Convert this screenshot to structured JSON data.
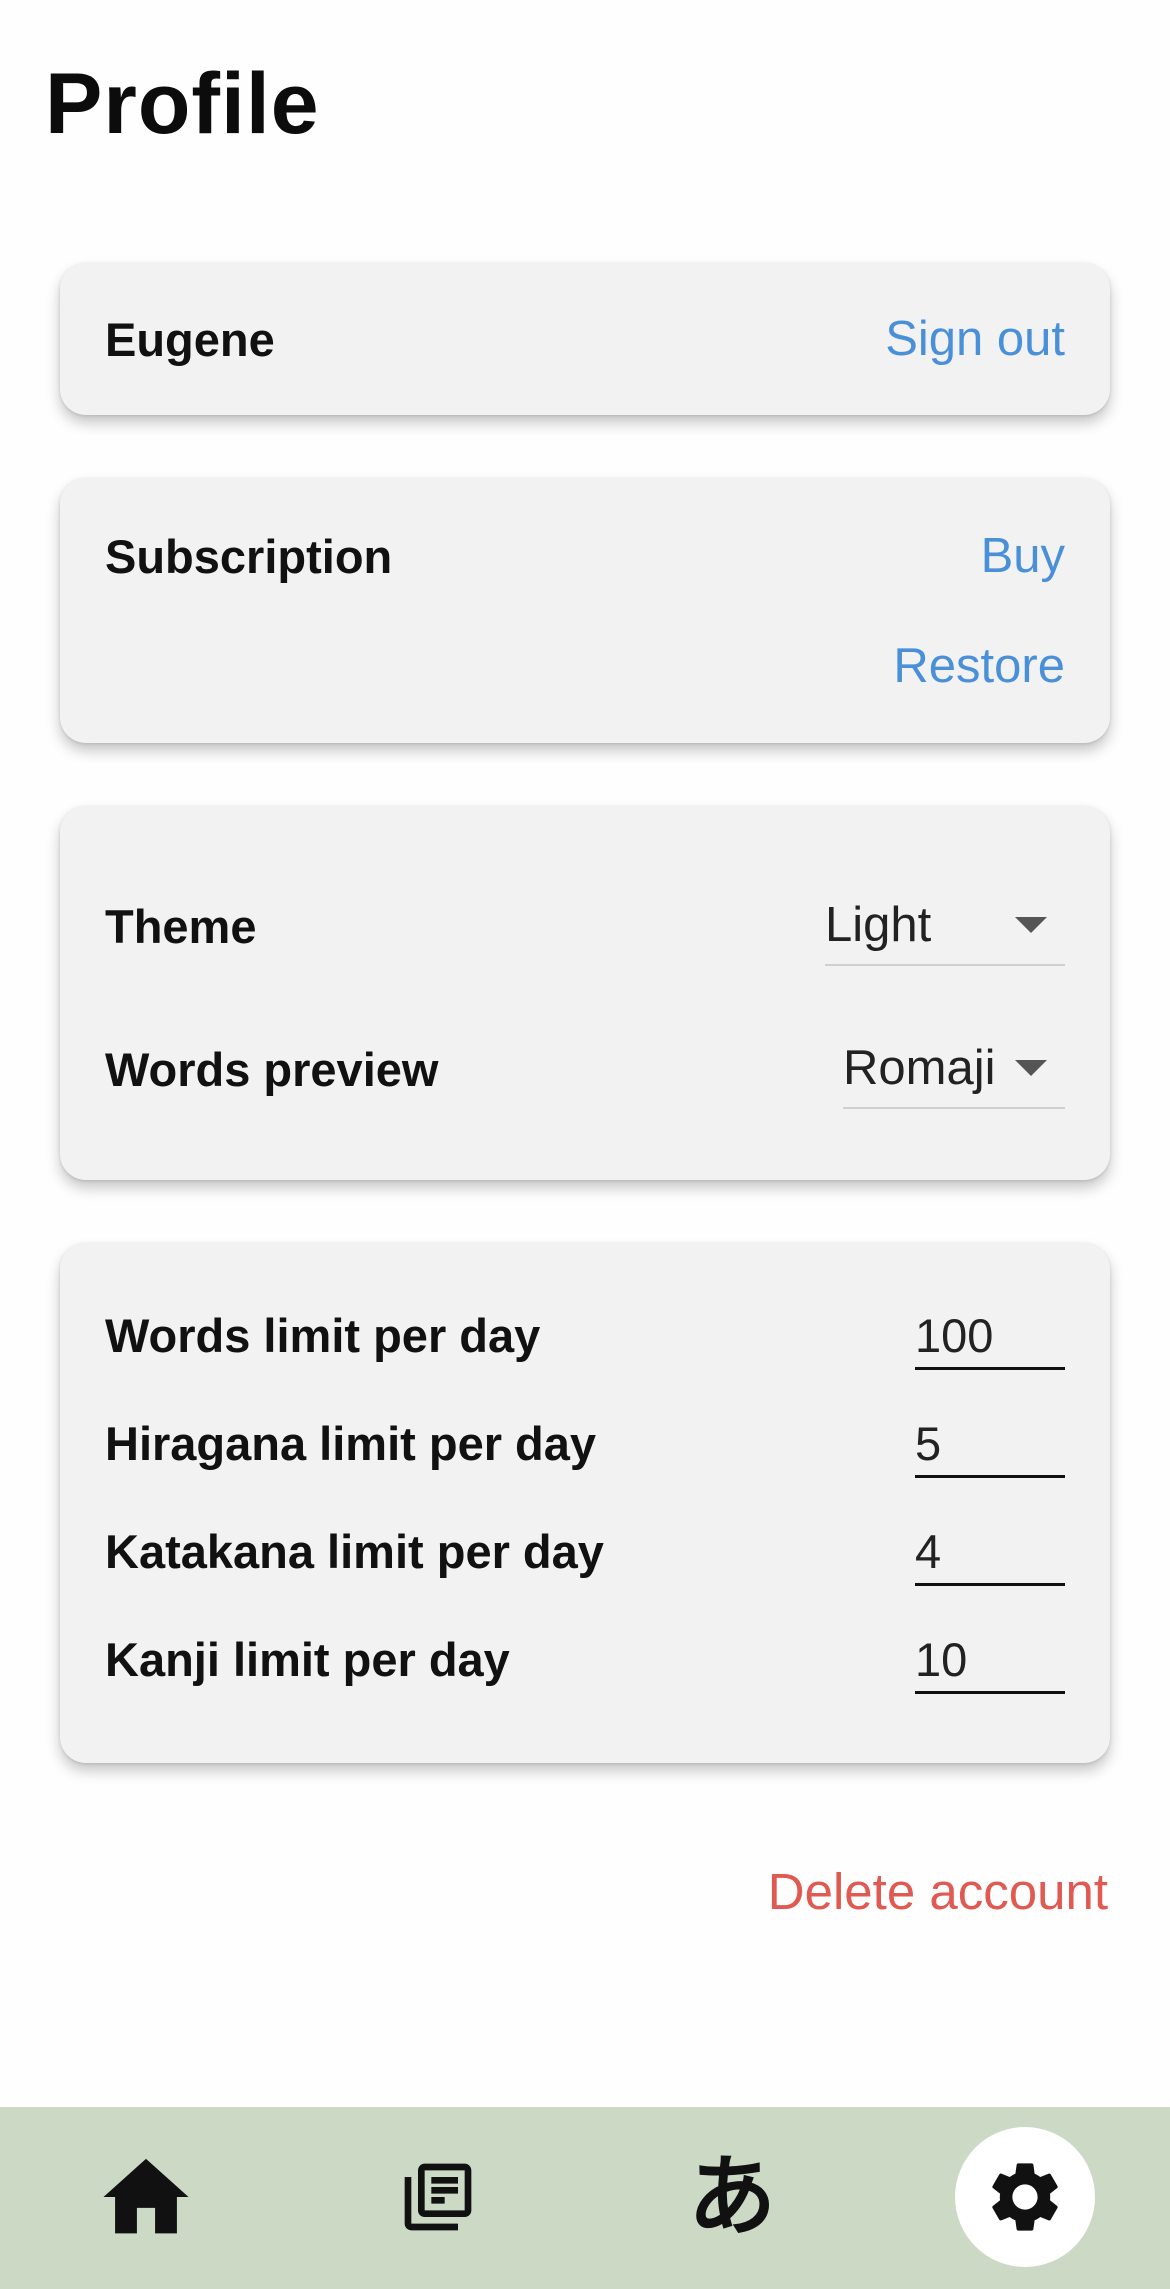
{
  "header": {
    "title": "Profile"
  },
  "account": {
    "name": "Eugene",
    "sign_out_label": "Sign out"
  },
  "subscription": {
    "label": "Subscription",
    "buy_label": "Buy",
    "restore_label": "Restore"
  },
  "preferences": {
    "theme": {
      "label": "Theme",
      "value": "Light"
    },
    "words_preview": {
      "label": "Words preview",
      "value": "Romaji"
    }
  },
  "limits": [
    {
      "label": "Words limit per day",
      "value": "100"
    },
    {
      "label": "Hiragana limit per day",
      "value": "5"
    },
    {
      "label": "Katakana limit per day",
      "value": "4"
    },
    {
      "label": "Kanji limit per day",
      "value": "10"
    }
  ],
  "delete_account_label": "Delete account",
  "bottom_nav": {
    "items": [
      {
        "icon": "home-icon"
      },
      {
        "icon": "library-icon"
      },
      {
        "icon": "hiragana-icon",
        "glyph": "あ"
      },
      {
        "icon": "gear-icon",
        "active": true
      }
    ]
  },
  "colors": {
    "link": "#4a90d9",
    "danger": "#e05a52",
    "nav_bar": "#ccdac5",
    "card": "#f2f2f2"
  }
}
